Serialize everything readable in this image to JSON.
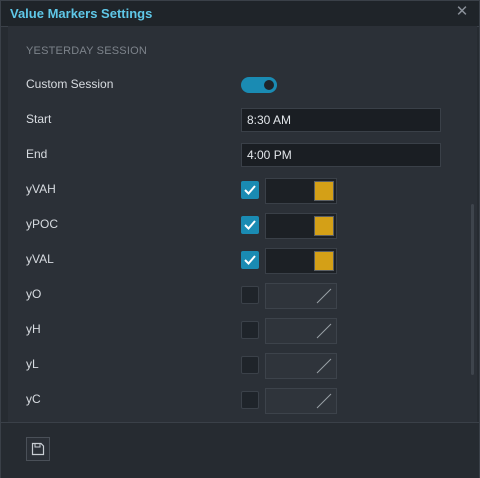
{
  "window": {
    "title": "Value Markers Settings"
  },
  "section": {
    "label": "YESTERDAY SESSION"
  },
  "custom_session": {
    "label": "Custom Session",
    "enabled": true
  },
  "start": {
    "label": "Start",
    "value": "8:30 AM"
  },
  "end": {
    "label": "End",
    "value": "4:00 PM"
  },
  "markers": [
    {
      "label": "yVAH",
      "checked": true,
      "color": "#d4a017"
    },
    {
      "label": "yPOC",
      "checked": true,
      "color": "#d4a017"
    },
    {
      "label": "yVAL",
      "checked": true,
      "color": "#d4a017"
    },
    {
      "label": "yO",
      "checked": false,
      "color": "none"
    },
    {
      "label": "yH",
      "checked": false,
      "color": "none"
    },
    {
      "label": "yL",
      "checked": false,
      "color": "none"
    },
    {
      "label": "yC",
      "checked": false,
      "color": "none"
    }
  ],
  "colors": {
    "accent": "#1a8bb3",
    "title": "#5fc8e8",
    "swatch": "#d4a017"
  },
  "icons": {
    "close": "close-icon",
    "save": "save-icon"
  }
}
